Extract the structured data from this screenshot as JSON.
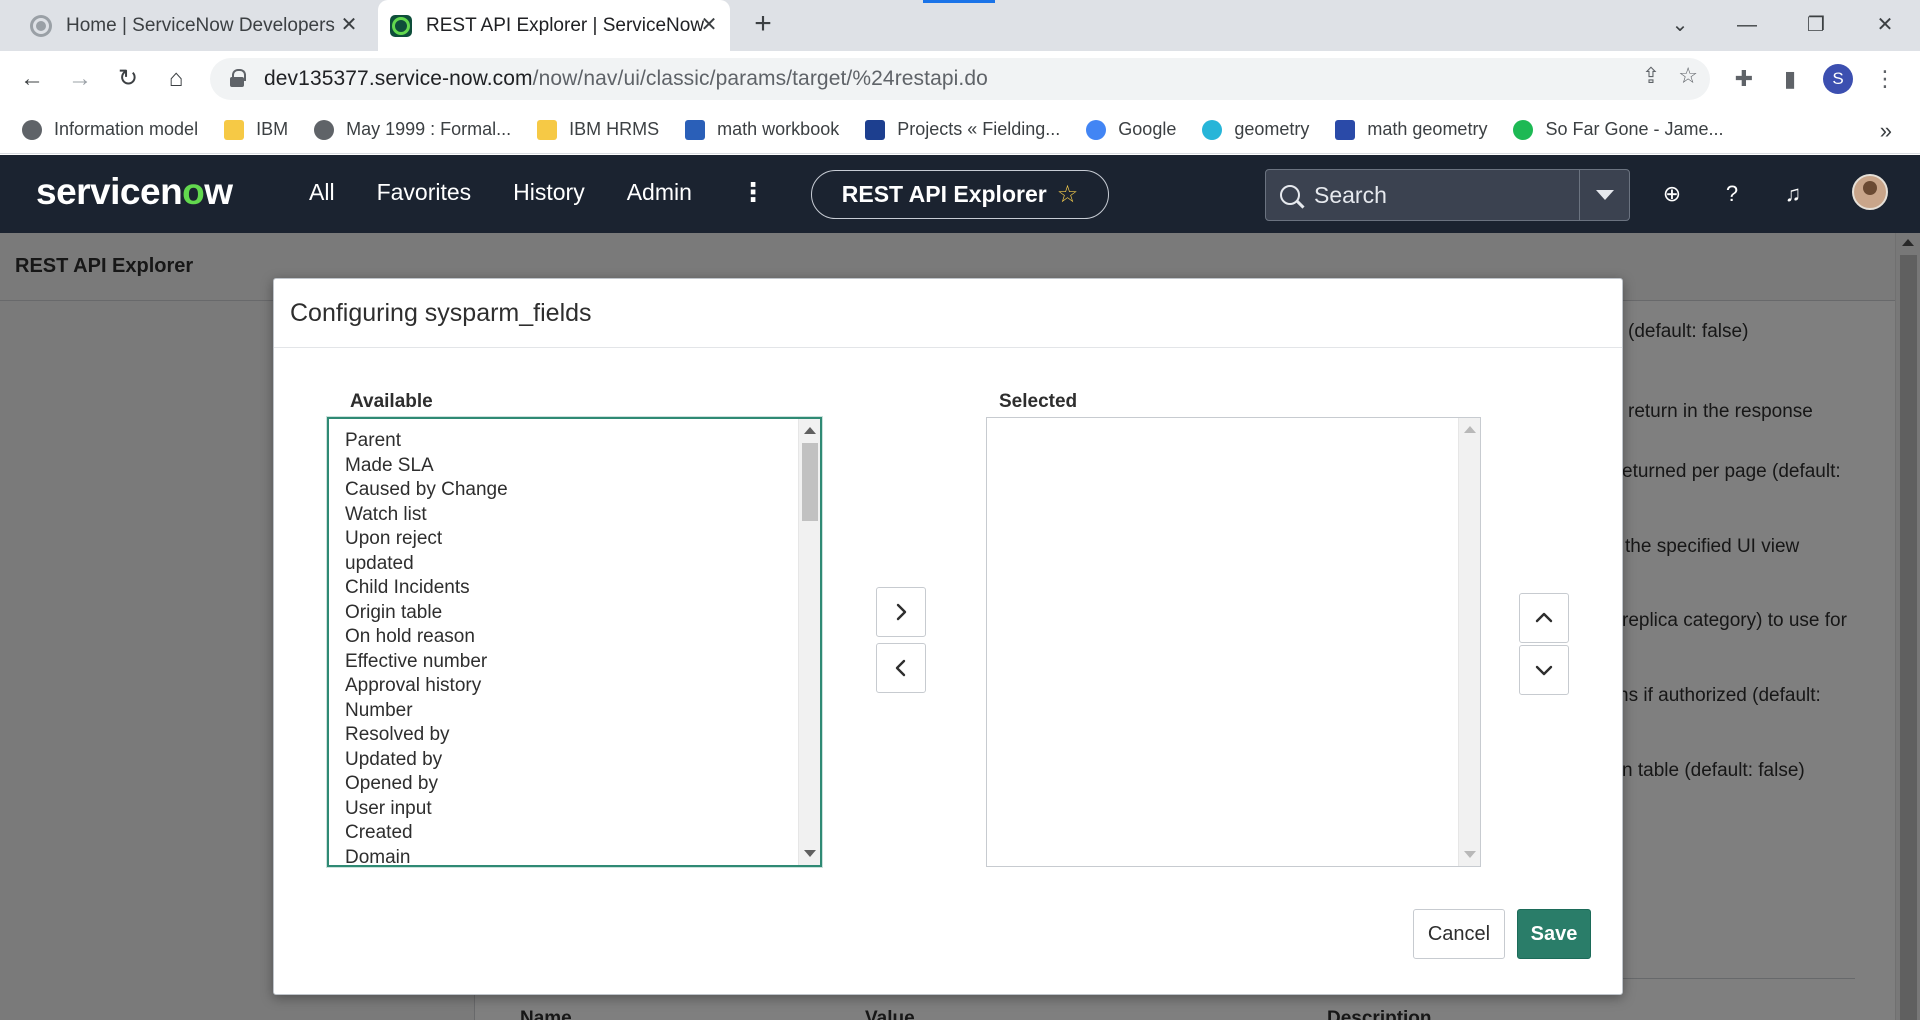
{
  "browser": {
    "tabs": [
      {
        "title": "Home | ServiceNow Developers",
        "active": false
      },
      {
        "title": "REST API Explorer | ServiceNow",
        "active": true
      }
    ],
    "new_tab": "+",
    "url_host": "dev135377.service-now.com",
    "url_path": "/now/nav/ui/classic/params/target/%24restapi.do",
    "profile_initial": "S",
    "bookmarks": [
      {
        "label": "Information model",
        "icon": "globe-icon",
        "color": "#5f6368"
      },
      {
        "label": "IBM",
        "icon": "folder-icon",
        "color": "#f6c945"
      },
      {
        "label": "May 1999 : Formal...",
        "icon": "globe-icon",
        "color": "#5f6368"
      },
      {
        "label": "IBM HRMS",
        "icon": "folder-icon",
        "color": "#f6c945"
      },
      {
        "label": "math workbook",
        "icon": "s-logo-icon",
        "color": "#2a5fb8"
      },
      {
        "label": "Projects « Fielding...",
        "icon": "fm-logo-icon",
        "color": "#1d3f8f"
      },
      {
        "label": "Google",
        "icon": "google-icon",
        "color": "#4285f4"
      },
      {
        "label": "geometry",
        "icon": "geometry-icon",
        "color": "#27b5d8"
      },
      {
        "label": "math geometry",
        "icon": "math-logo-icon",
        "color": "#2a4aa8"
      },
      {
        "label": "So Far Gone - Jame...",
        "icon": "spotify-icon",
        "color": "#1db954"
      }
    ],
    "bookmarks_more": "»"
  },
  "sn_header": {
    "logo_pre": "servicen",
    "logo_o": "o",
    "logo_post": "w",
    "nav": [
      "All",
      "Favorites",
      "History",
      "Admin"
    ],
    "more": "⋮",
    "context_title": "REST API Explorer",
    "favorite_star": "☆",
    "search_placeholder": "Search"
  },
  "page": {
    "title": "REST API Explorer",
    "background_lines": [
      "(default: false)",
      "return in the response",
      "eturned per page (default:",
      "the specified UI view",
      "replica category) to use for",
      "ns if authorized (default:",
      "n table (default: false)"
    ],
    "table_headers": [
      "Name",
      "Value",
      "Description"
    ]
  },
  "modal": {
    "title": "Configuring sysparm_fields",
    "available_label": "Available",
    "selected_label": "Selected",
    "available_items": [
      "Parent",
      "Made SLA",
      "Caused by Change",
      "Watch list",
      "Upon reject",
      "updated",
      "Child Incidents",
      "Origin table",
      "On hold reason",
      "Effective number",
      "Approval history",
      "Number",
      "Resolved by",
      "Updated by",
      "Opened by",
      "User input",
      "Created",
      "Domain"
    ],
    "selected_items": [],
    "cancel_label": "Cancel",
    "save_label": "Save",
    "accent_color": "#2a7d69"
  }
}
